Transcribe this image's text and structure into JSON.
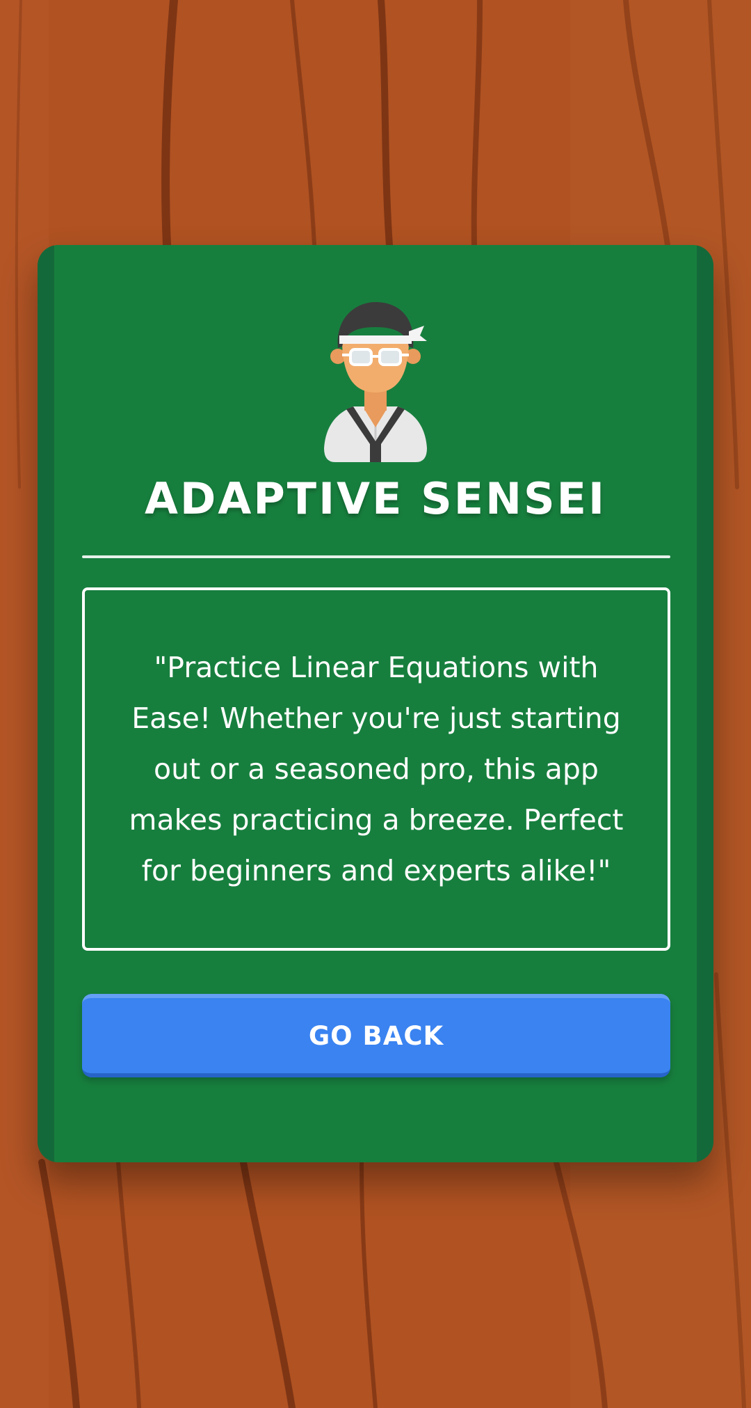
{
  "background": {
    "type": "wood-texture",
    "color": "#b05222"
  },
  "card": {
    "color": "#177f3e",
    "avatar_icon": "sensei-avatar-icon",
    "title": "ADAPTIVE SENSEI",
    "description": "\"Practice Linear Equations with Ease! Whether you're just starting out or a seasoned pro, this app makes practicing a breeze. Perfect for beginners and experts alike!\"",
    "button_label": "GO BACK",
    "button_color": "#3a83f1"
  }
}
